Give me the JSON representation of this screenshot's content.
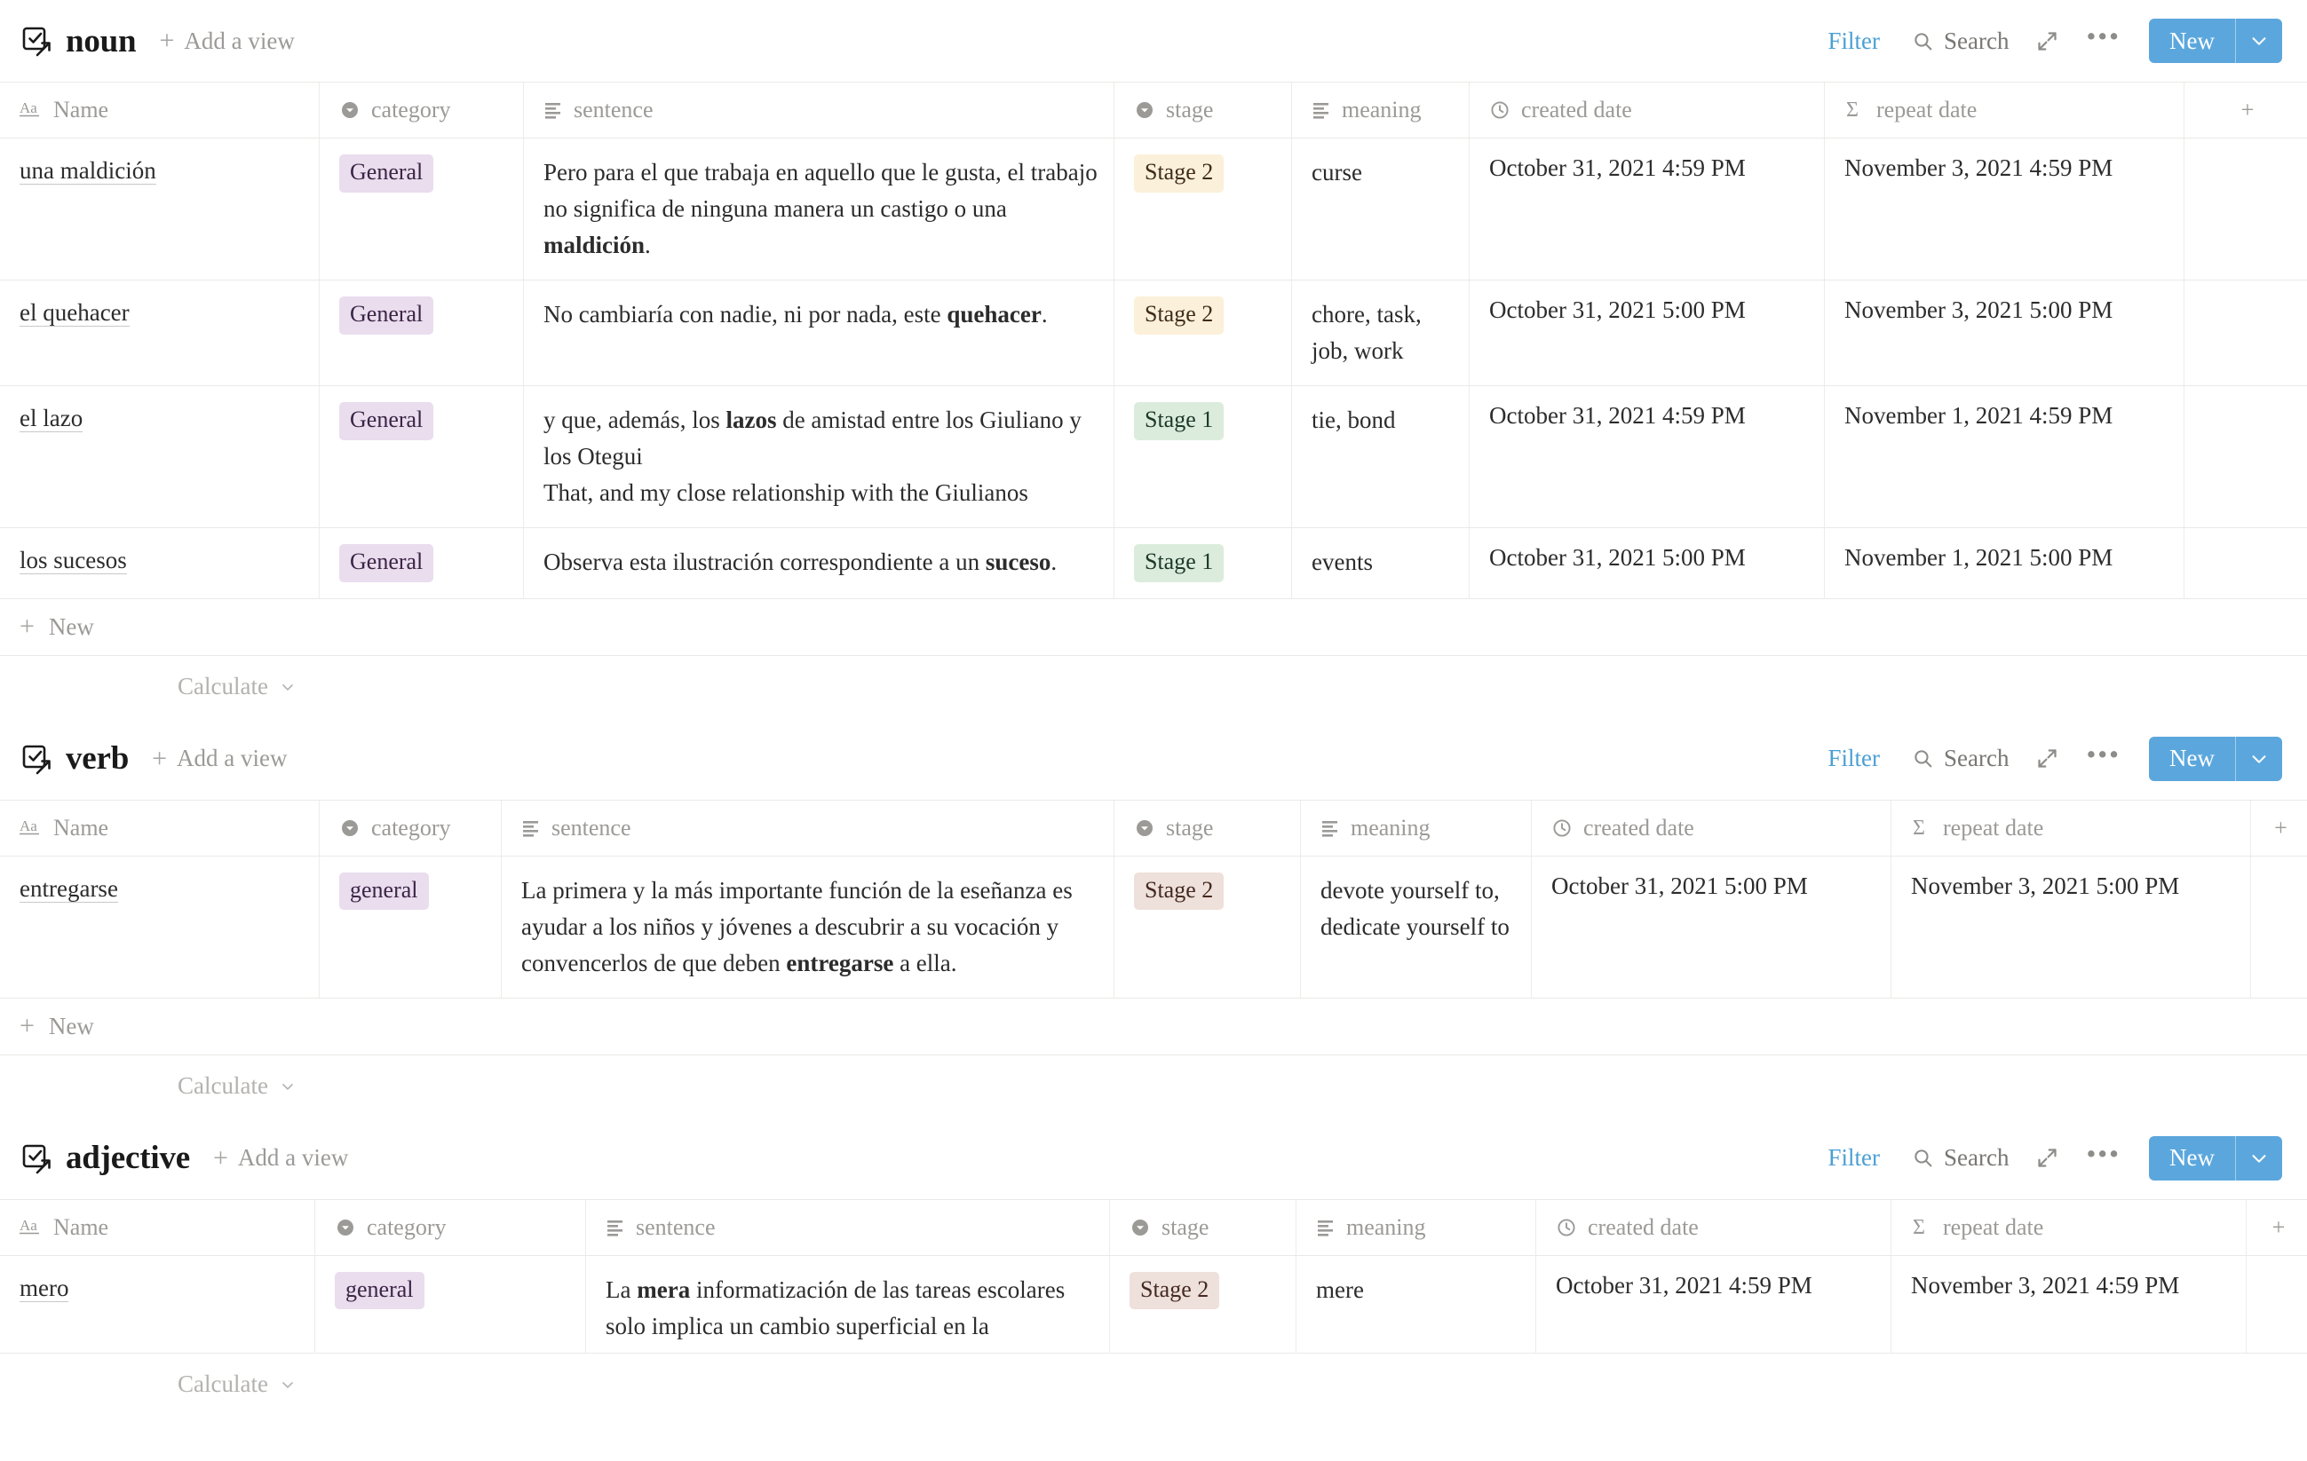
{
  "toolbar": {
    "filter_label": "Filter",
    "search_label": "Search",
    "dots_label": "•••",
    "new_label": "New",
    "add_view_label": "Add a view",
    "plus_label": "+",
    "caret_label": "˅"
  },
  "footer": {
    "new_row_label": "New",
    "calculate_label": "Calculate",
    "calculate_caret": "˅"
  },
  "columns": {
    "name": "Name",
    "name_icon_label": "Aa",
    "category": "category",
    "sentence": "sentence",
    "stage": "stage",
    "meaning": "meaning",
    "created_date": "created date",
    "repeat_date": "repeat date",
    "add_column": "+"
  },
  "colors": {
    "accent_blue": "#5ba7dd",
    "filter_blue": "#4a9fd4",
    "badge_general_bg": "#e9ddee",
    "badge_general_fg": "#3c2445",
    "badge_stage2_yellow_bg": "#fbf0d9",
    "badge_stage1_green_bg": "#dcecdc",
    "badge_stage2_pink_bg": "#eee0da",
    "muted_text": "#9b9a97",
    "border": "#e9e9e7"
  },
  "databases": [
    {
      "id": "noun",
      "title": "noun",
      "rows": [
        {
          "name": "una maldición",
          "category": "General",
          "category_style": "badge-general",
          "sentence_parts": [
            {
              "t": "Pero para el que trabaja en aquello que le gusta, el trabajo no significa de ninguna manera un castigo o una ",
              "b": false
            },
            {
              "t": "maldición",
              "b": true
            },
            {
              "t": ".",
              "b": false
            }
          ],
          "stage": "Stage 2",
          "stage_style": "badge-stage2-yellow",
          "meaning": "curse",
          "created_date": "October 31, 2021 4:59 PM",
          "repeat_date": "November 3, 2021 4:59 PM"
        },
        {
          "name": "el quehacer",
          "category": "General",
          "category_style": "badge-general",
          "sentence_parts": [
            {
              "t": "No cambiaría con nadie, ni por nada, este ",
              "b": false
            },
            {
              "t": "quehacer",
              "b": true
            },
            {
              "t": ".",
              "b": false
            }
          ],
          "stage": "Stage 2",
          "stage_style": "badge-stage2-yellow",
          "meaning": "chore, task, job, work",
          "created_date": "October 31, 2021 5:00 PM",
          "repeat_date": "November 3, 2021 5:00 PM"
        },
        {
          "name": "el lazo",
          "category": "General",
          "category_style": "badge-general",
          "sentence_parts": [
            {
              "t": "y que, además, los ",
              "b": false
            },
            {
              "t": "lazos",
              "b": true
            },
            {
              "t": " de amistad entre los Giuliano y los Otegui\nThat, and my close relationship with the Giulianos",
              "b": false
            }
          ],
          "stage": "Stage 1",
          "stage_style": "badge-stage1-green",
          "meaning": "tie, bond",
          "created_date": "October 31, 2021 4:59 PM",
          "repeat_date": "November 1, 2021 4:59 PM"
        },
        {
          "name": "los sucesos",
          "category": "General",
          "category_style": "badge-general",
          "sentence_parts": [
            {
              "t": "Observa esta ilustración correspondiente a un ",
              "b": false
            },
            {
              "t": "suceso",
              "b": true
            },
            {
              "t": ".",
              "b": false
            }
          ],
          "stage": "Stage 1",
          "stage_style": "badge-stage1-green",
          "meaning": "events",
          "created_date": "October 31, 2021 5:00 PM",
          "repeat_date": "November 1, 2021 5:00 PM"
        }
      ]
    },
    {
      "id": "verb",
      "title": "verb",
      "rows": [
        {
          "name": "entregarse",
          "category": "general",
          "category_style": "badge-general",
          "sentence_parts": [
            {
              "t": "La primera y la más importante función de la eseñanza es ayudar a los niños y jóvenes a descubrir a su vocación y convencerlos de que deben ",
              "b": false
            },
            {
              "t": "entregarse",
              "b": true
            },
            {
              "t": " a ella.",
              "b": false
            }
          ],
          "stage": "Stage 2",
          "stage_style": "badge-stage2-pink",
          "meaning": "devote yourself to, dedicate yourself to",
          "created_date": "October 31, 2021 5:00 PM",
          "repeat_date": "November 3, 2021 5:00 PM"
        }
      ]
    },
    {
      "id": "adjective",
      "title": "adjective",
      "rows": [
        {
          "name": "mero",
          "category": "general",
          "category_style": "badge-general",
          "sentence_parts": [
            {
              "t": "La ",
              "b": false
            },
            {
              "t": "mera",
              "b": true
            },
            {
              "t": " informatización de las tareas escolares solo implica un cambio superficial en la adquisición de conocimientos si",
              "b": false
            }
          ],
          "stage": "Stage 2",
          "stage_style": "badge-stage2-pink",
          "meaning": "mere",
          "created_date": "October 31, 2021 4:59 PM",
          "repeat_date": "November 3, 2021 4:59 PM"
        }
      ]
    }
  ]
}
